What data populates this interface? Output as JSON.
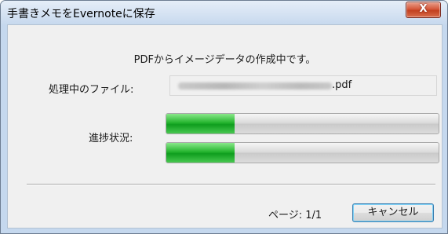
{
  "window": {
    "title": "手書きメモをEvernoteに保存",
    "close_glyph": "X"
  },
  "dialog": {
    "message": "PDFからイメージデータの作成中です。",
    "file_label": "処理中のファイル:",
    "file_extension": ".pdf",
    "progress_label": "進捗状況:",
    "progress_bars": [
      {
        "value": 0.25
      },
      {
        "value": 0.25
      }
    ],
    "page_indicator": "ページ: 1/1",
    "cancel_label": "キャンセル"
  },
  "colors": {
    "progress_fill": "#1faf2a",
    "close_button": "#c9452a",
    "frame": "#c5d8ee"
  }
}
